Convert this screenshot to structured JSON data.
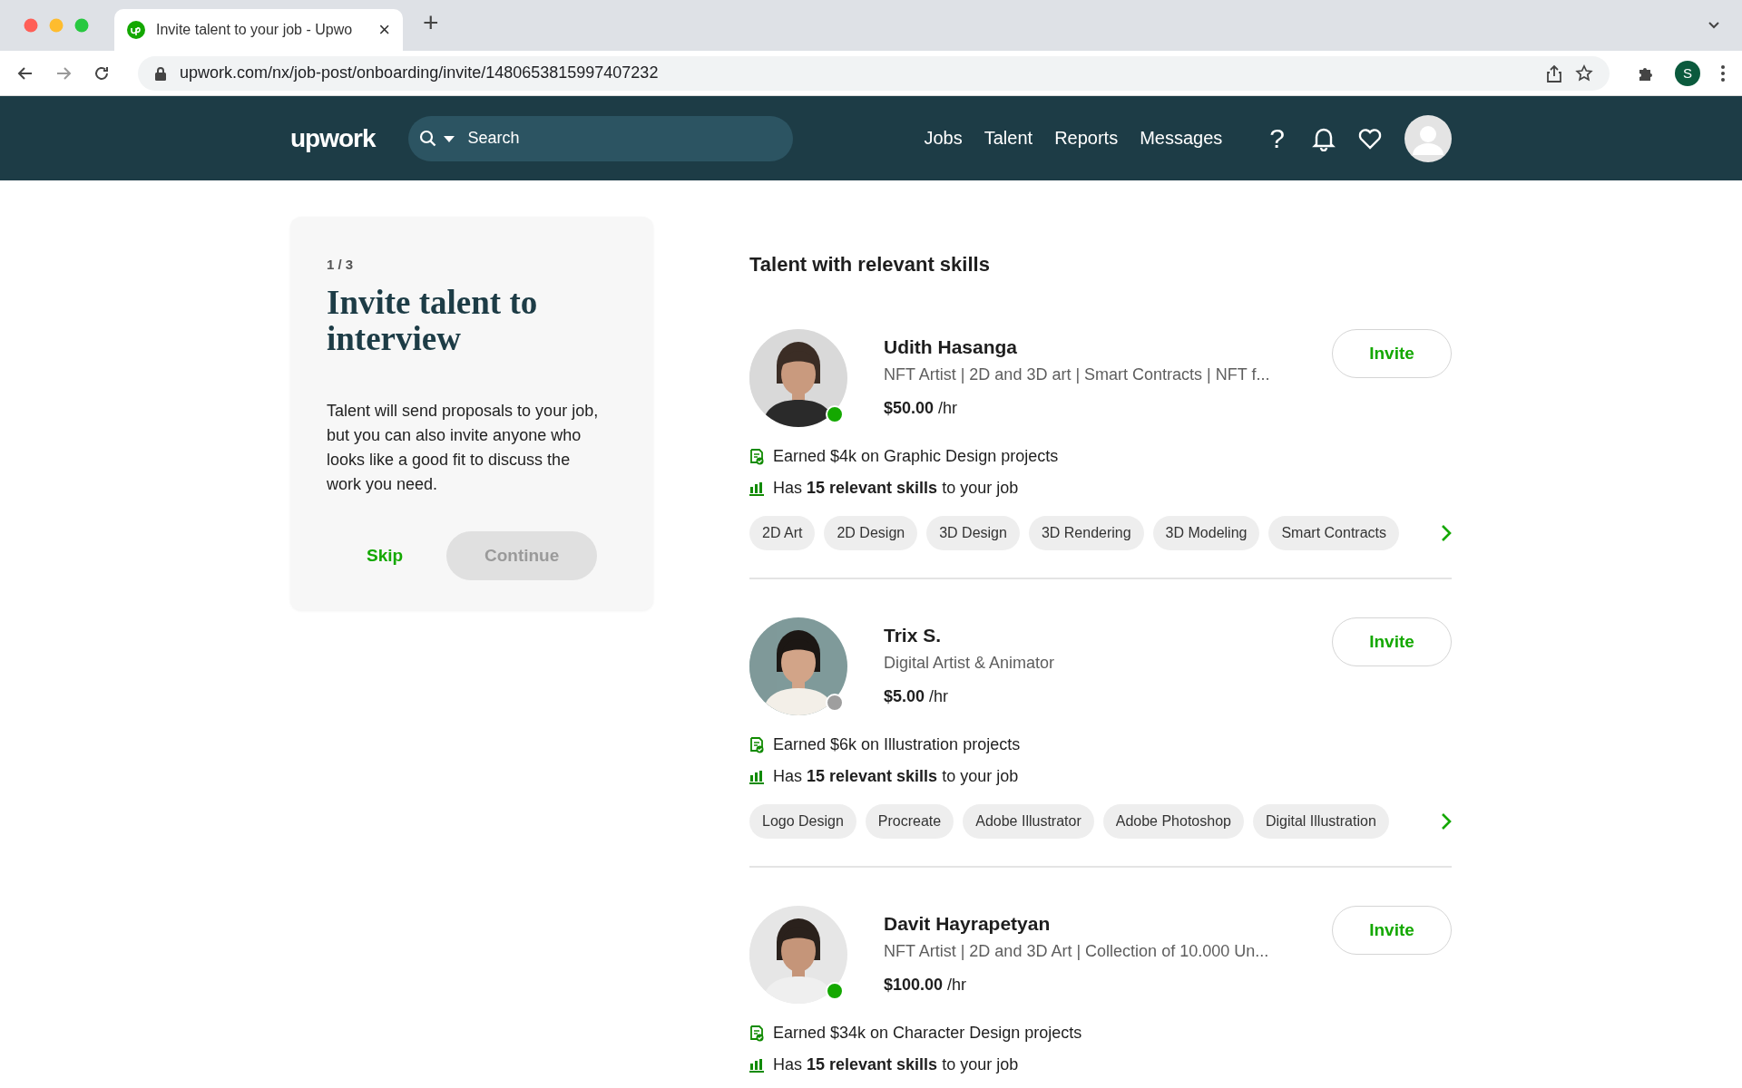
{
  "browser": {
    "tab": {
      "title": "Invite talent to your job - Upwo",
      "close": "×"
    },
    "new_tab": "+",
    "url": "upwork.com/nx/job-post/onboarding/invite/1480653815997407232",
    "profile_initial": "S"
  },
  "nav": {
    "logo": "upwork",
    "search": {
      "placeholder": "Search"
    },
    "links": [
      "Jobs",
      "Talent",
      "Reports",
      "Messages"
    ],
    "help": "?"
  },
  "onboarding": {
    "step": "1 / 3",
    "title": "Invite talent to interview",
    "body": "Talent will send proposals to your job, but you can also invite anyone who looks like a good fit to discuss the work you need.",
    "skip": "Skip",
    "continue": {
      "label": "Continue",
      "disabled": true
    }
  },
  "talent_section": {
    "heading": "Talent with relevant skills",
    "talent": [
      {
        "name": "Udith Hasanga",
        "title": "NFT Artist | 2D and 3D art | Smart Contracts | NFT f...",
        "rate": "**$50.00** /hr",
        "online": true,
        "earned": "Earned $4k on Graphic Design projects",
        "skills_note": "Has **15 relevant skills** to your job",
        "skills": [
          "2D Art",
          "2D Design",
          "3D Design",
          "3D Rendering",
          "3D Modeling",
          "Smart Contracts"
        ],
        "invite": "Invite"
      },
      {
        "name": "Trix S.",
        "title": "Digital Artist & Animator",
        "rate": "**$5.00** /hr",
        "online": false,
        "earned": "Earned $6k on Illustration projects",
        "skills_note": "Has **15 relevant skills** to your job",
        "skills": [
          "Logo Design",
          "Procreate",
          "Adobe Illustrator",
          "Adobe Photoshop",
          "Digital Illustration"
        ],
        "invite": "Invite"
      },
      {
        "name": "Davit Hayrapetyan",
        "title": "NFT Artist | 2D and 3D Art | Collection of 10.000 Un...",
        "rate": "**$100.00** /hr",
        "online": true,
        "earned": "Earned $34k on Character Design projects",
        "skills_note": "Has **15 relevant skills** to your job",
        "invite": "Invite"
      }
    ]
  }
}
